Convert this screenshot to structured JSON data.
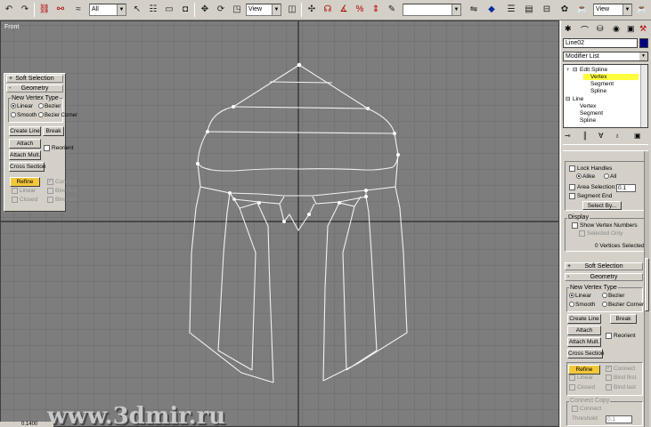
{
  "toolbar": {
    "selection_filter": "All",
    "reference_coord_1": "View",
    "named_selection": "",
    "reference_coord_2": "View"
  },
  "viewport": {
    "label": "Front",
    "watermark": "www.3dmir.ru",
    "coord_readout": "0.1400"
  },
  "floating_panel": {
    "soft_selection": "Soft Selection",
    "geometry": "Geometry",
    "new_vertex_type": "New Vertex Type",
    "linear": "Linear",
    "bezier": "Bezier",
    "smooth": "Smooth",
    "bezier_corner": "Bezier Corner",
    "create_line": "Create Line",
    "break": "Break",
    "attach": "Attach",
    "reorient": "Reorient",
    "attach_mult": "Attach Mult.",
    "cross_section": "Cross Section",
    "refine": "Refine",
    "connect": "Connect",
    "linear_chk": "Linear",
    "bind_first": "Bind first",
    "closed": "Closed",
    "bind_last": "Bind last"
  },
  "command_panel": {
    "object_name": "Line02",
    "object_color": "#000080",
    "modifier_list": "Modifier List",
    "stack": [
      {
        "label": "Edit Spline"
      },
      {
        "label": "Vertex"
      },
      {
        "label": "Segment"
      },
      {
        "label": "Spline"
      },
      {
        "label": "Line"
      },
      {
        "label": "Vertex"
      },
      {
        "label": "Segment"
      },
      {
        "label": "Spline"
      }
    ],
    "selection": {
      "lock_handles": "Lock Handles",
      "alike": "Alike",
      "all": "All",
      "area_selection": "Area Selection:",
      "area_value": "0.1",
      "segment_end": "Segment End",
      "select_by": "Select By...",
      "display": "Display",
      "show_vertex_numbers": "Show Vertex Numbers",
      "selected_only": "Selected Only",
      "vertices_selected": "0 Vertices Selected"
    },
    "soft_selection": "Soft Selection",
    "geometry": {
      "title": "Geometry",
      "new_vertex_type": "New Vertex Type",
      "linear": "Linear",
      "bezier": "Bezier",
      "smooth": "Smooth",
      "bezier_corner": "Bezier Corner",
      "create_line": "Create Line",
      "break": "Break",
      "attach": "Attach",
      "reorient": "Reorient",
      "attach_mult": "Attach Mult.",
      "cross_section": "Cross Section",
      "refine": "Refine",
      "connect": "Connect",
      "linear_chk": "Linear",
      "bind_first": "Bind first",
      "closed": "Closed",
      "bind_last": "Bind last",
      "connect_copy": "Connect Copy",
      "connect_copy_connect": "Connect",
      "threshold": "Threshold",
      "threshold_value": "0.1"
    }
  }
}
